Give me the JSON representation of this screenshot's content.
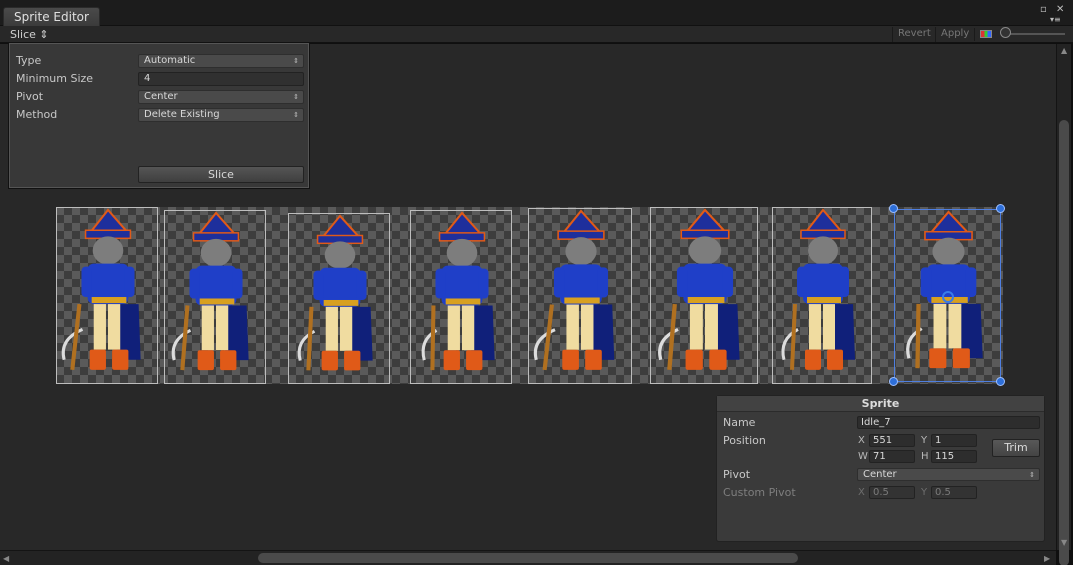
{
  "window": {
    "tab_title": "Sprite Editor",
    "close_glyph": "✕",
    "maximize_glyph": "▫",
    "menu_glyph": "▾≡"
  },
  "toolbar": {
    "slice_menu": "Slice ⇕",
    "revert": "Revert",
    "apply": "Apply"
  },
  "slice_panel": {
    "type_label": "Type",
    "type_value": "Automatic",
    "min_size_label": "Minimum Size",
    "min_size_value": "4",
    "pivot_label": "Pivot",
    "pivot_value": "Center",
    "method_label": "Method",
    "method_value": "Delete Existing",
    "slice_button": "Slice",
    "dropdown_arrow": "⇕"
  },
  "sprite_panel": {
    "header": "Sprite",
    "name_label": "Name",
    "name_value": "Idle_7",
    "position_label": "Position",
    "x_label": "X",
    "x_value": "551",
    "y_label": "Y",
    "y_value": "1",
    "w_label": "W",
    "w_value": "71",
    "h_label": "H",
    "h_value": "115",
    "trim_button": "Trim",
    "pivot_label": "Pivot",
    "pivot_value": "Center",
    "custom_pivot_label": "Custom Pivot",
    "cp_x_label": "X",
    "cp_x_value": "0.5",
    "cp_y_label": "Y",
    "cp_y_value": "0.5"
  },
  "sprites": {
    "count": 8,
    "selected_index": 7,
    "selection_color": "#2e6fd9"
  },
  "colors": {
    "coat": "#1f3fc8",
    "hat": "#1e2f9c",
    "pants": "#f0dca0",
    "boots": "#e05a18",
    "skin": "#7d7d7d"
  }
}
